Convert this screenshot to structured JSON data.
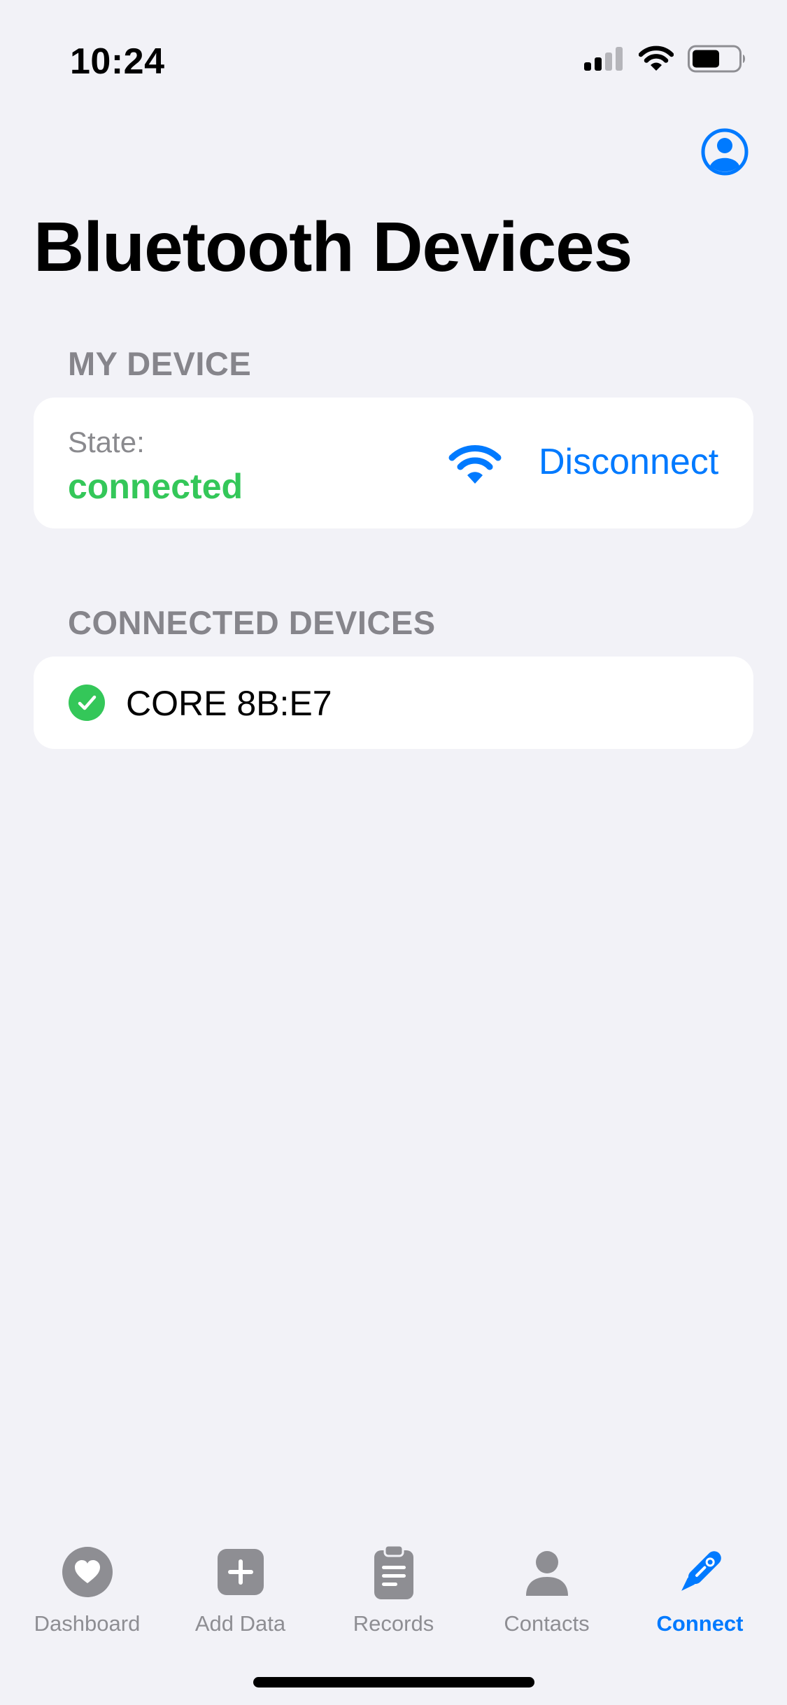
{
  "status_bar": {
    "time": "10:24",
    "icons": [
      "cellular-signal-icon",
      "wifi-icon",
      "battery-icon"
    ]
  },
  "header": {
    "title": "Bluetooth Devices",
    "profile_icon": "person-circle-icon"
  },
  "my_device": {
    "section_title": "MY DEVICE",
    "state_label": "State:",
    "state_value": "connected",
    "state_icon": "wifi-icon",
    "action_label": "Disconnect"
  },
  "connected_devices": {
    "section_title": "CONNECTED DEVICES",
    "items": [
      {
        "name": "CORE 8B:E7",
        "icon": "checkmark-circle-icon"
      }
    ]
  },
  "tab_bar": {
    "tabs": [
      {
        "label": "Dashboard",
        "icon": "heart-icon",
        "active": false
      },
      {
        "label": "Add Data",
        "icon": "plus-square-icon",
        "active": false
      },
      {
        "label": "Records",
        "icon": "clipboard-icon",
        "active": false
      },
      {
        "label": "Contacts",
        "icon": "person-icon",
        "active": false
      },
      {
        "label": "Connect",
        "icon": "thermometer-icon",
        "active": true
      }
    ]
  },
  "colors": {
    "accent": "#007AFF",
    "success": "#34C759",
    "background": "#F2F2F7",
    "secondary_text": "#8E8E93"
  }
}
